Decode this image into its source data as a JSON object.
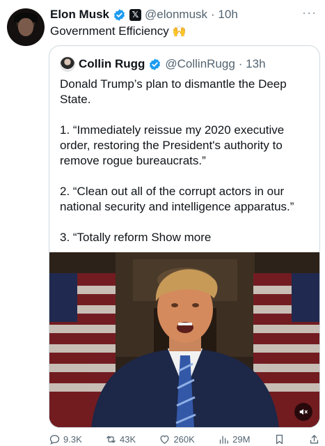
{
  "post": {
    "author_name": "Elon Musk",
    "author_handle": "@elonmusk",
    "time": "· 10h",
    "text": "Government Efficiency",
    "emoji": "🙌"
  },
  "quote": {
    "author_name": "Collin Rugg",
    "author_handle": "@CollinRugg",
    "time": "· 13h",
    "paragraphs": [
      "Donald Trump’s plan to dismantle the Deep State.",
      "1. “Immediately reissue my 2020 executive order, restoring the President's authority to remove rogue bureaucrats.”",
      "2. “Clean out all of the corrupt actors in our national security and intelligence apparatus.”"
    ],
    "last_line": "3. “Totally reform",
    "show_more": "Show more"
  },
  "actions": {
    "replies": "9.3K",
    "reposts": "43K",
    "likes": "260K",
    "views": "29M"
  },
  "icons": {
    "verified": "verified-badge-icon",
    "affiliation": "x-logo-icon",
    "more": "more-icon",
    "mute": "mute-icon",
    "reply": "reply-icon",
    "repost": "repost-icon",
    "like": "heart-icon",
    "views": "views-icon",
    "bookmark": "bookmark-icon",
    "share": "share-icon"
  },
  "colors": {
    "verified": "#1d9bf0",
    "text": "#0f1419",
    "muted": "#536471",
    "border": "#cfd9de"
  }
}
